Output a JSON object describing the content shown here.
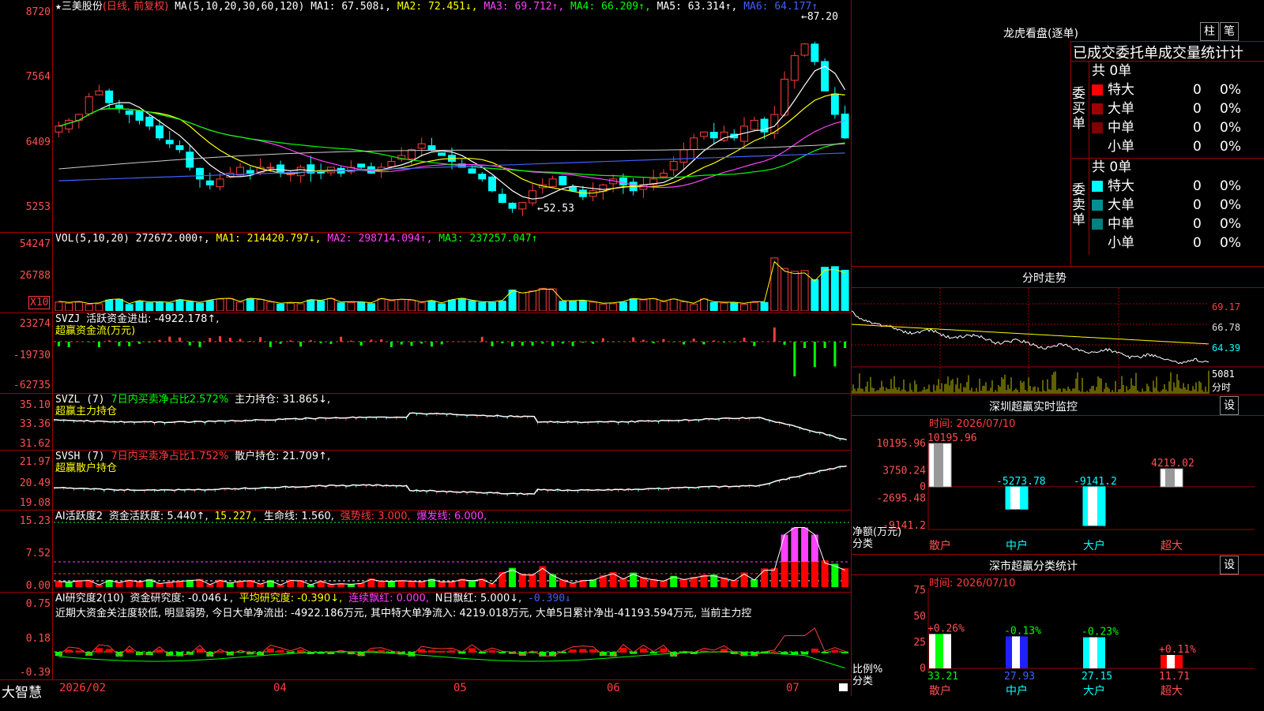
{
  "stock": {
    "star": "★",
    "name": "三美股份",
    "period": "(日线, 前复权)"
  },
  "ma": {
    "label": "MA(5,10,20,30,60,120)",
    "ma1": "MA1: 67.508↓,",
    "ma2": "MA2: 72.451↓,",
    "ma3": "MA3: 69.712↑,",
    "ma4": "MA4: 66.209↑,",
    "ma5": "MA5: 63.314↑,",
    "ma6": "MA6: 64.177↑"
  },
  "price_axis": [
    "8720",
    "7564",
    "6409",
    "5253"
  ],
  "price_marks": {
    "high": "←87.20",
    "low": "←52.53"
  },
  "vol": {
    "label": "VOL(5,10,20)",
    "value": "272672.000↑,",
    "ma1": "MA1: 214420.797↓,",
    "ma2": "MA2: 298714.094↑,",
    "ma3": "MA3: 237257.047↑",
    "axis": [
      "54247",
      "26788"
    ],
    "unit": "X10"
  },
  "svzj": {
    "label": "SVZJ",
    "text": "活跃资金进出: -4922.178↑,",
    "sub": "超赢资金流(万元)",
    "axis": [
      "23274",
      "-19730",
      "-62735"
    ]
  },
  "svzl": {
    "label": "SVZL (7)",
    "text1": "7日内买卖净占比2.572%",
    "text2": "主力持仓: 31.865↓,",
    "sub": "超赢主力持仓",
    "axis": [
      "35.10",
      "33.36",
      "31.62"
    ]
  },
  "svsh": {
    "label": "SVSH (7)",
    "text1": "7日内买卖净占比1.752%",
    "text2": "散户持仓: 21.709↑,",
    "sub": "超赢散户持仓",
    "axis": [
      "21.97",
      "20.49",
      "19.08"
    ]
  },
  "ai1": {
    "label": "AI活跃度2",
    "t1": "资金活跃度: 5.440↑,",
    "t2": "15.227,",
    "t3": "生命线: 1.560,",
    "t4": "强势线: 3.000,",
    "t5": "爆发线: 6.000,",
    "axis": [
      "15.23",
      "7.52",
      "0.00"
    ]
  },
  "ai2": {
    "label": "AI研究度2(10)",
    "t1": "资金研究度: -0.046↓,",
    "t2": "平均研究度: -0.390↓,",
    "t3": "连续飘红: 0.000,",
    "t4": "N日飘红: 5.000↓,",
    "t5": "-0.390↓",
    "comment": "近期大资金关注度较低, 明显弱势, 今日大单净流出: -4922.186万元, 其中特大单净流入: 4219.018万元, 大单5日累计净出-41193.594万元, 当前主力控",
    "axis": [
      "0.75",
      "0.18",
      "-0.39"
    ]
  },
  "xaxis": {
    "brand": "大智慧",
    "labels": [
      "2026/02",
      "04",
      "05",
      "06",
      "07"
    ]
  },
  "lhb": {
    "title": "龙虎看盘(逐单)",
    "btn1": "柱",
    "btn2": "笔",
    "header": "已成交委托单成交量统计计",
    "buy_label": "委买单",
    "sell_label": "委卖单",
    "buy_total": "共 0单",
    "sell_total": "共 0单",
    "buy_rows": [
      {
        "name": "特大",
        "color": "#ff0000",
        "n": "0",
        "p": "0%"
      },
      {
        "name": "大单",
        "color": "#a00000",
        "n": "0",
        "p": "0%"
      },
      {
        "name": "中单",
        "color": "#800000",
        "n": "0",
        "p": "0%"
      },
      {
        "name": "小单",
        "color": "#000000",
        "n": "0",
        "p": "0%"
      }
    ],
    "sell_rows": [
      {
        "name": "特大",
        "color": "#00ffff",
        "n": "0",
        "p": "0%"
      },
      {
        "name": "大单",
        "color": "#009090",
        "n": "0",
        "p": "0%"
      },
      {
        "name": "中单",
        "color": "#008080",
        "n": "0",
        "p": "0%"
      },
      {
        "name": "小单",
        "color": "#000000",
        "n": "0",
        "p": "0%"
      }
    ]
  },
  "fenshi": {
    "title": "分时走势",
    "axis": [
      "69.17",
      "66.78",
      "64.39"
    ],
    "vol_label": "5081",
    "vol_unit": "分时"
  },
  "monitor": {
    "title": "深圳超赢实时监控",
    "btn": "设",
    "time": "时间: 2026/07/10",
    "axis": [
      "10195.96",
      "3750.24",
      "0",
      "-2695.48",
      "-9141.2"
    ],
    "unit1": "净额(万元)",
    "unit2": "分类",
    "categories": [
      "散户",
      "中户",
      "大户",
      "超大"
    ],
    "values": [
      10195.96,
      -5273.78,
      -9141.2,
      4219.02
    ],
    "value_labels": [
      "10195.96",
      "-5273.78",
      "-9141.2",
      "4219.02"
    ]
  },
  "stat": {
    "title": "深市超赢分类统计",
    "btn": "设",
    "time": "时间: 2026/07/10",
    "axis": [
      "75",
      "50",
      "25",
      "0"
    ],
    "unit1": "比例%",
    "unit2": "分类",
    "categories": [
      "散户",
      "中户",
      "大户",
      "超大"
    ],
    "values": [
      33.21,
      27.93,
      27.15,
      11.71
    ],
    "changes": [
      "+0.26%",
      "-0.13%",
      "-0.23%",
      "+0.11%"
    ],
    "value_labels": [
      "33.21",
      "27.93",
      "27.15",
      "11.71"
    ]
  },
  "chart_data": {
    "type": "candlestick",
    "title": "三美股份 (日线, 前复权)",
    "ylim": [
      52.53,
      87.2
    ],
    "x_labels": [
      "2026/02",
      "04",
      "05",
      "06",
      "07"
    ],
    "closes": [
      68,
      69,
      70,
      73,
      74,
      72,
      71,
      70,
      69,
      68,
      66,
      65,
      64,
      61,
      59,
      58,
      59,
      60,
      61,
      60,
      61,
      61,
      60,
      60,
      61,
      60,
      60,
      61,
      60,
      61,
      61,
      60,
      61,
      62,
      63,
      64,
      65,
      64,
      63,
      62,
      61,
      60,
      59,
      57,
      55,
      54,
      55,
      57,
      58,
      59,
      58,
      57,
      56,
      57,
      58,
      59,
      58,
      57,
      58,
      59,
      60,
      62,
      64,
      66,
      67,
      66,
      67,
      66,
      68,
      69,
      67,
      70,
      76,
      80,
      82,
      79,
      74,
      70,
      66
    ]
  }
}
